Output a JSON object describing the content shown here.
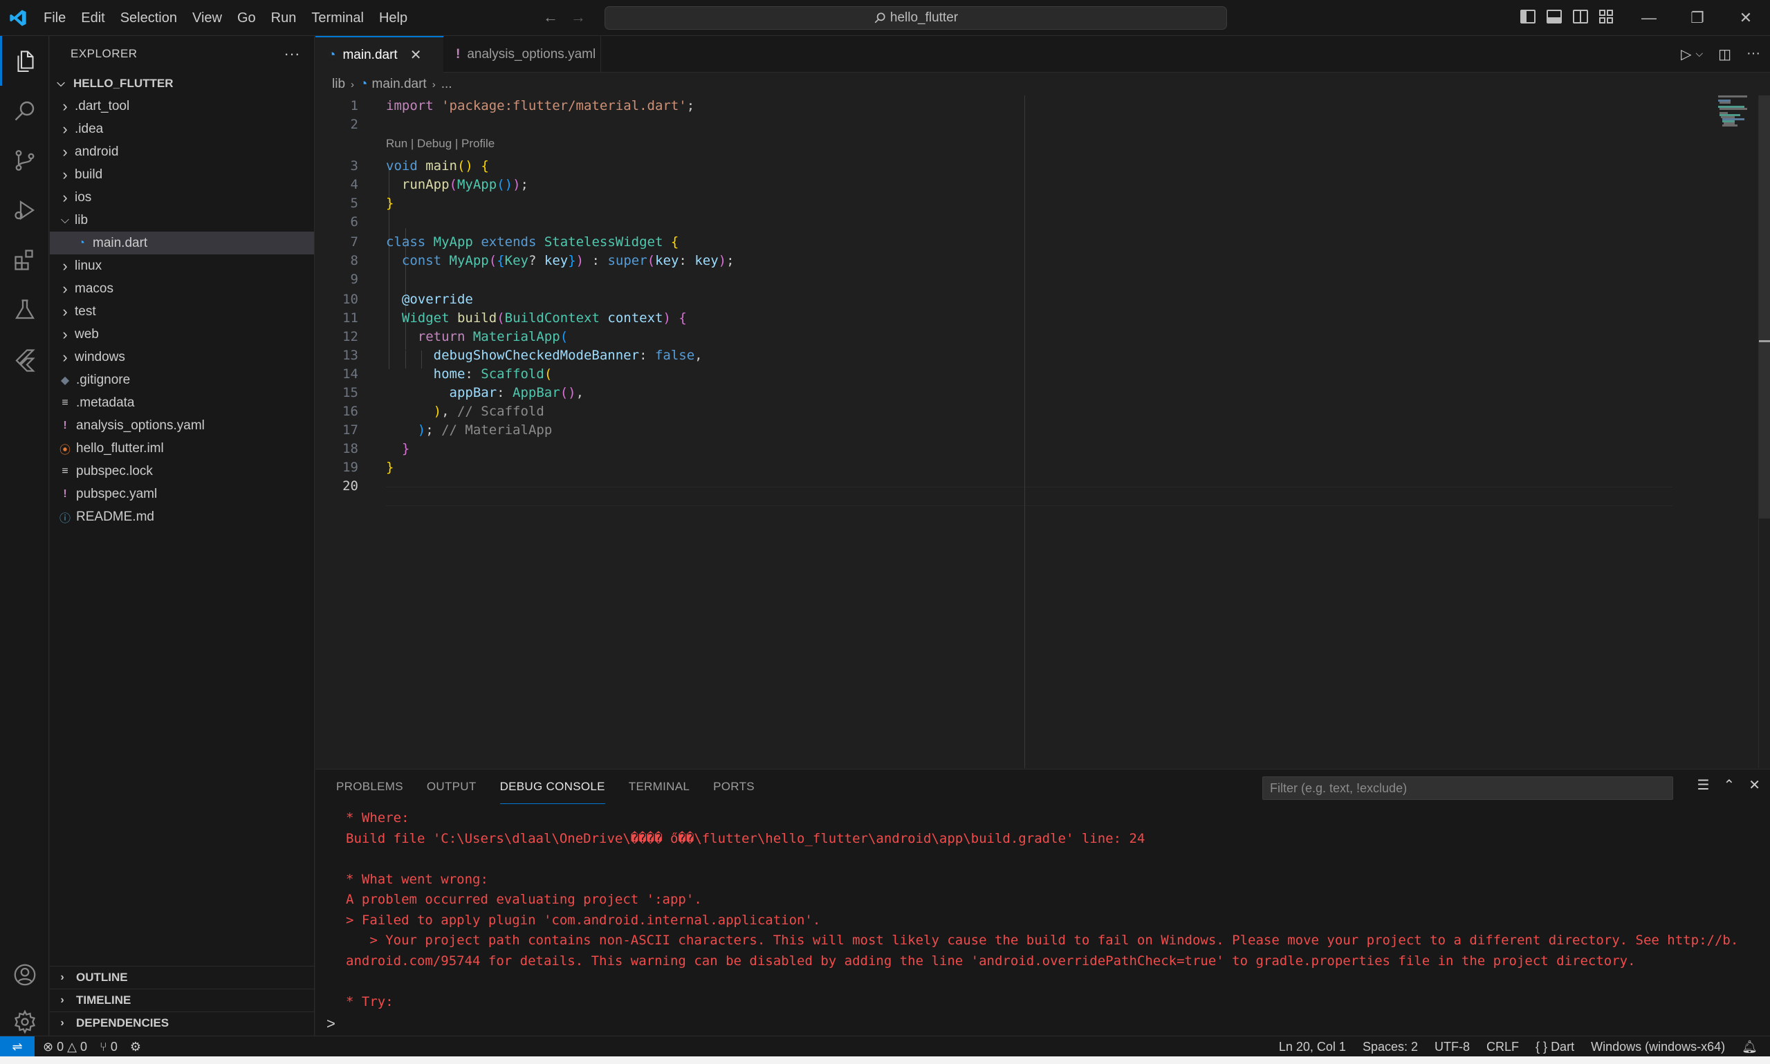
{
  "titlebar": {
    "menu": [
      "File",
      "Edit",
      "Selection",
      "View",
      "Go",
      "Run",
      "Terminal",
      "Help"
    ],
    "search_text": "hello_flutter"
  },
  "sidebar": {
    "title": "EXPLORER",
    "root": "HELLO_FLUTTER",
    "tree": [
      {
        "label": ".dart_tool",
        "kind": "folder",
        "depth": 1
      },
      {
        "label": ".idea",
        "kind": "folder",
        "depth": 1
      },
      {
        "label": "android",
        "kind": "folder",
        "depth": 1
      },
      {
        "label": "build",
        "kind": "folder",
        "depth": 1
      },
      {
        "label": "ios",
        "kind": "folder",
        "depth": 1
      },
      {
        "label": "lib",
        "kind": "folder-open",
        "depth": 1
      },
      {
        "label": "main.dart",
        "kind": "dart",
        "depth": 2,
        "selected": true
      },
      {
        "label": "linux",
        "kind": "folder",
        "depth": 1
      },
      {
        "label": "macos",
        "kind": "folder",
        "depth": 1
      },
      {
        "label": "test",
        "kind": "folder",
        "depth": 1
      },
      {
        "label": "web",
        "kind": "folder",
        "depth": 1
      },
      {
        "label": "windows",
        "kind": "folder",
        "depth": 1
      },
      {
        "label": ".gitignore",
        "kind": "git",
        "depth": 1
      },
      {
        "label": ".metadata",
        "kind": "text",
        "depth": 1
      },
      {
        "label": "analysis_options.yaml",
        "kind": "yaml",
        "depth": 1
      },
      {
        "label": "hello_flutter.iml",
        "kind": "rss",
        "depth": 1
      },
      {
        "label": "pubspec.lock",
        "kind": "text",
        "depth": 1
      },
      {
        "label": "pubspec.yaml",
        "kind": "yaml",
        "depth": 1
      },
      {
        "label": "README.md",
        "kind": "info",
        "depth": 1
      }
    ],
    "sections": [
      "OUTLINE",
      "TIMELINE",
      "DEPENDENCIES"
    ]
  },
  "tabs": [
    {
      "label": "main.dart",
      "active": true
    },
    {
      "label": "analysis_options.yaml",
      "active": false
    }
  ],
  "breadcrumb": [
    "lib",
    "main.dart",
    "..."
  ],
  "editor": {
    "codelens": "Run | Debug | Profile",
    "current_line": 20,
    "line_numbers": [
      "1",
      "2",
      "3",
      "4",
      "5",
      "6",
      "7",
      "8",
      "9",
      "10",
      "11",
      "12",
      "13",
      "14",
      "15",
      "16",
      "17",
      "18",
      "19",
      "20"
    ]
  },
  "panel": {
    "tabs": [
      "PROBLEMS",
      "OUTPUT",
      "DEBUG CONSOLE",
      "TERMINAL",
      "PORTS"
    ],
    "active_tab": "DEBUG CONSOLE",
    "filter_placeholder": "Filter (e.g. text, !exclude)",
    "console_lines": [
      "* Where:",
      "Build file 'C:\\Users\\dlaal\\OneDrive\\���� ő��\\flutter\\hello_flutter\\android\\app\\build.gradle' line: 24",
      "",
      "* What went wrong:",
      "A problem occurred evaluating project ':app'.",
      "> Failed to apply plugin 'com.android.internal.application'.",
      "   > Your project path contains non-ASCII characters. This will most likely cause the build to fail on Windows. Please move your project to a different directory. See http://b.",
      "android.com/95744 for details. This warning can be disabled by adding the line 'android.overridePathCheck=true' to gradle.properties file in the project directory.",
      "",
      "* Try:"
    ],
    "prompt": ">"
  },
  "statusbar": {
    "errors": "0",
    "warnings": "0",
    "ports": "0",
    "position": "Ln 20, Col 1",
    "spaces": "Spaces: 2",
    "encoding": "UTF-8",
    "eol": "CRLF",
    "language": "Dart",
    "language_icon": "{ }",
    "platform": "Windows (windows-x64)"
  },
  "colors": {
    "accent": "#0078d4",
    "error_text": "#f14c4c",
    "background": "#1f1f1f",
    "chrome": "#181818"
  }
}
